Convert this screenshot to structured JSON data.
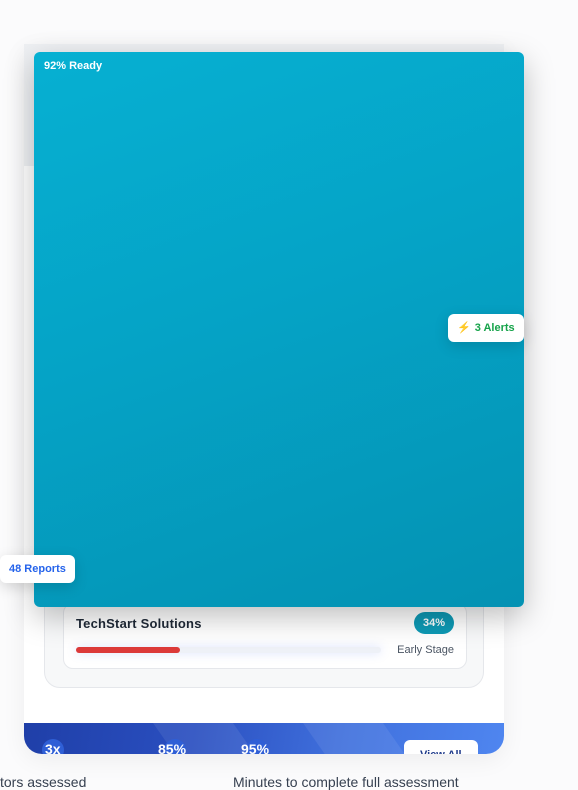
{
  "overlay": {
    "ready_label": "92% Ready",
    "alerts": {
      "icon": "lightning-bolt-icon",
      "label": "3 Alerts"
    },
    "reports": {
      "label": "48 Reports"
    }
  },
  "company": {
    "name": "TechStart Solutions",
    "percent_label": "34%",
    "progress": 0.34,
    "stage": "Early Stage"
  },
  "stats": {
    "items": [
      "3x",
      "85%",
      "95%"
    ],
    "view_all": "View All"
  },
  "captions": {
    "left": "tors assessed",
    "right": "Minutes to complete full assessment"
  },
  "colors": {
    "overlay": "#05a3c6",
    "badge": "#0e9ab5",
    "progress": "#dc3a3a",
    "alerts": "#16a34a",
    "reports": "#2563eb",
    "band": "#2a4fc0"
  }
}
